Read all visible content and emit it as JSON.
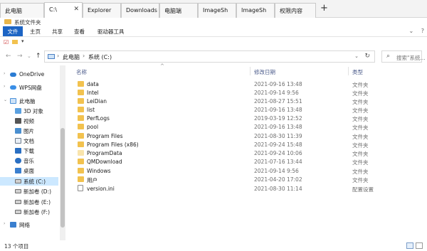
{
  "tabs": [
    {
      "label": "此电脑"
    },
    {
      "label": "C:\\",
      "active": true
    },
    {
      "label": "Explorer"
    },
    {
      "label": "Downloads"
    },
    {
      "label": "电脑端"
    },
    {
      "label": "ImageSh"
    },
    {
      "label": "ImageSh"
    },
    {
      "label": "权限内容"
    }
  ],
  "new_tab_symbol": "+",
  "window": {
    "title": "系统文件夹"
  },
  "ribbon": {
    "tabs": [
      "文件",
      "主页",
      "共享",
      "查看",
      "驱动器工具"
    ],
    "right_icons": [
      "chevron-icon",
      "help-icon"
    ]
  },
  "address": {
    "crumbs": [
      "此电脑",
      "系统 (C:)"
    ],
    "refresh_symbol": "↻"
  },
  "search": {
    "placeholder": "搜索\"系统..."
  },
  "navigation": [
    {
      "label": "OneDrive",
      "icon": "cloud-icon",
      "color": "#2b7cd3"
    },
    {
      "label": "WPS网盘",
      "icon": "cloud-icon",
      "color": "#3a8ee6"
    },
    {
      "label": "此电脑",
      "icon": "computer-icon",
      "color": "#4a90d9"
    },
    {
      "label": "3D 对象",
      "icon": "cube-icon",
      "color": "#5aa0e0"
    },
    {
      "label": "视频",
      "icon": "video-icon",
      "color": "#555555"
    },
    {
      "label": "图片",
      "icon": "picture-icon",
      "color": "#4a8fd0"
    },
    {
      "label": "文档",
      "icon": "document-icon",
      "color": "#6b7b8c"
    },
    {
      "label": "下载",
      "icon": "download-icon",
      "color": "#2a6fc2"
    },
    {
      "label": "音乐",
      "icon": "music-icon",
      "color": "#2a6fc2"
    },
    {
      "label": "桌面",
      "icon": "desktop-icon",
      "color": "#3a7fcf"
    },
    {
      "label": "系统 (C:)",
      "icon": "drive-icon",
      "color": "#707070",
      "selected": true
    },
    {
      "label": "新加卷 (D:)",
      "icon": "drive-icon",
      "color": "#707070"
    },
    {
      "label": "新加卷 (E:)",
      "icon": "drive-icon",
      "color": "#707070"
    },
    {
      "label": "新加卷 (F:)",
      "icon": "drive-icon",
      "color": "#707070"
    },
    {
      "label": "网络",
      "icon": "network-icon",
      "color": "#3a7fcf"
    }
  ],
  "columns": {
    "name": "名称",
    "date": "修改日期",
    "type": "类型"
  },
  "files": [
    {
      "name": "data",
      "date": "2021-09-16 13:48",
      "type": "文件夹",
      "kind": "folder"
    },
    {
      "name": "Intel",
      "date": "2021-09-14 9:56",
      "type": "文件夹",
      "kind": "folder"
    },
    {
      "name": "LeiDian",
      "date": "2021-08-27 15:51",
      "type": "文件夹",
      "kind": "folder"
    },
    {
      "name": "list",
      "date": "2021-09-16 13:48",
      "type": "文件夹",
      "kind": "folder"
    },
    {
      "name": "PerfLogs",
      "date": "2019-03-19 12:52",
      "type": "文件夹",
      "kind": "folder"
    },
    {
      "name": "pool",
      "date": "2021-09-16 13:48",
      "type": "文件夹",
      "kind": "folder"
    },
    {
      "name": "Program Files",
      "date": "2021-08-30 11:39",
      "type": "文件夹",
      "kind": "folder"
    },
    {
      "name": "Program Files (x86)",
      "date": "2021-09-24 15:48",
      "type": "文件夹",
      "kind": "folder"
    },
    {
      "name": "ProgramData",
      "date": "2021-09-24 10:06",
      "type": "文件夹",
      "kind": "hidden-folder"
    },
    {
      "name": "QMDownload",
      "date": "2021-07-16 13:44",
      "type": "文件夹",
      "kind": "folder"
    },
    {
      "name": "Windows",
      "date": "2021-09-14 9:56",
      "type": "文件夹",
      "kind": "folder"
    },
    {
      "name": "用户",
      "date": "2021-04-20 17:02",
      "type": "文件夹",
      "kind": "folder"
    },
    {
      "name": "version.ini",
      "date": "2021-08-30 11:14",
      "type": "配置设置",
      "kind": "file"
    }
  ],
  "status": {
    "count": "13 个项目"
  }
}
